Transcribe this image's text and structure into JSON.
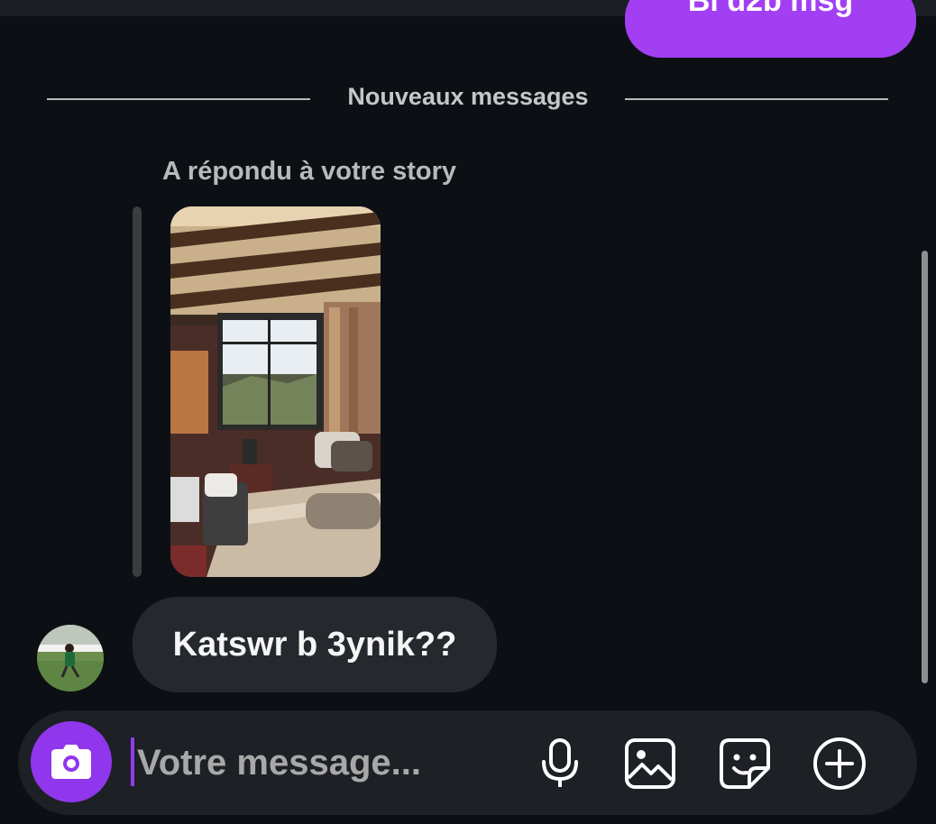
{
  "thread": {
    "sent_message_partial": "Bi d2b msg",
    "divider_label": "Nouveaux messages",
    "story_reply_caption": "A répondu à votre story",
    "received_message": "Katswr b 3ynik??"
  },
  "composer": {
    "placeholder": "Votre message..."
  },
  "icons": {
    "camera": "camera-icon",
    "microphone": "microphone-icon",
    "gallery": "image-icon",
    "sticker": "sticker-icon",
    "add": "plus-circle-icon"
  },
  "colors": {
    "background": "#0c1014",
    "accent": "#9036ed",
    "sent_bubble": "#a23ff2",
    "received_bubble": "#25292e",
    "composer_bg": "#1d2024"
  }
}
